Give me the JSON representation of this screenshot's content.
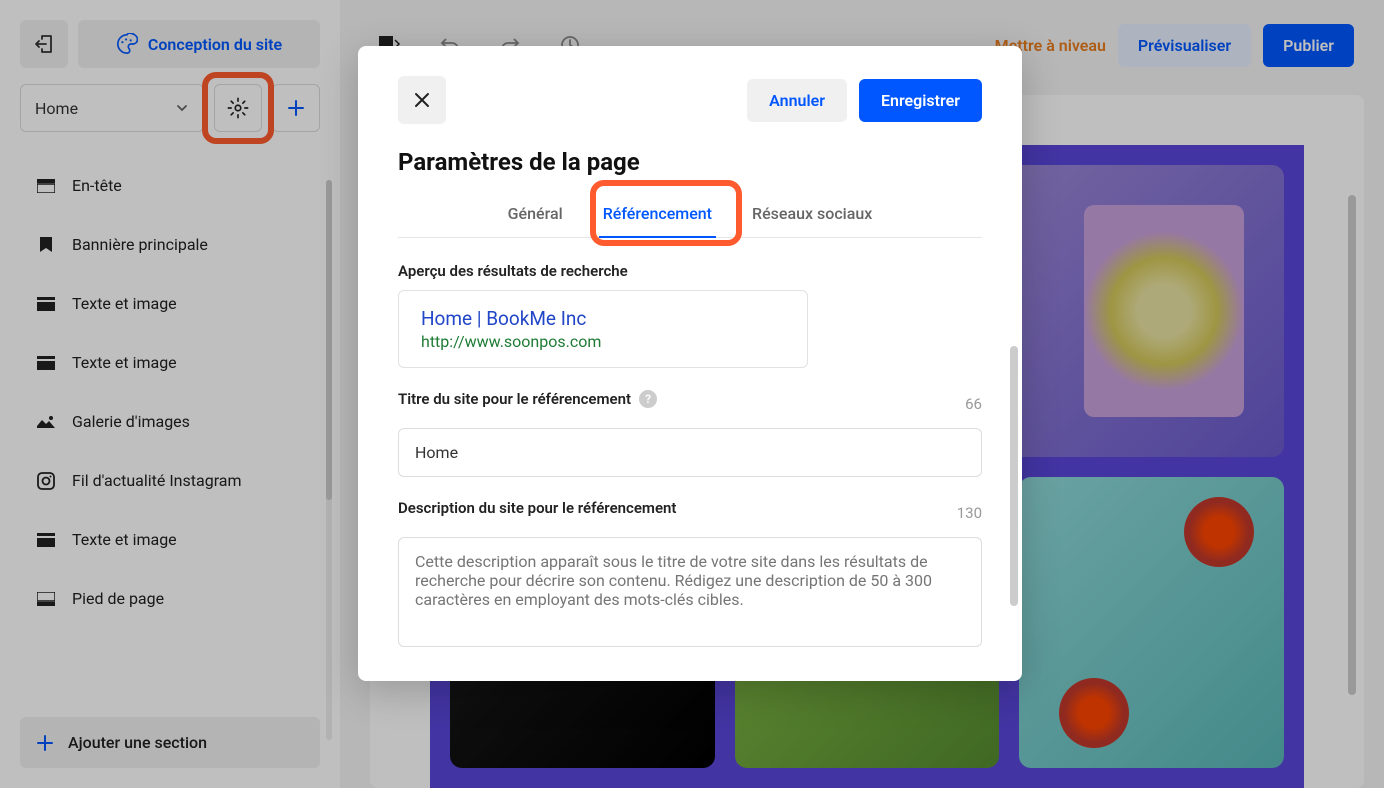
{
  "sidebar": {
    "design_label": "Conception du site",
    "page_select": "Home",
    "sections": [
      {
        "label": "En-tête",
        "icon": "header"
      },
      {
        "label": "Bannière principale",
        "icon": "bookmark"
      },
      {
        "label": "Texte et image",
        "icon": "block"
      },
      {
        "label": "Texte et image",
        "icon": "block"
      },
      {
        "label": "Galerie d'images",
        "icon": "gallery"
      },
      {
        "label": "Fil d'actualité Instagram",
        "icon": "instagram"
      },
      {
        "label": "Texte et image",
        "icon": "block"
      },
      {
        "label": "Pied de page",
        "icon": "footer"
      }
    ],
    "add_section": "Ajouter une section"
  },
  "topbar": {
    "upgrade": "Mettre à niveau",
    "preview": "Prévisualiser",
    "publish": "Publier"
  },
  "modal": {
    "title": "Paramètres de la page",
    "cancel": "Annuler",
    "save": "Enregistrer",
    "tabs": {
      "general": "Général",
      "seo": "Référencement",
      "social": "Réseaux sociaux"
    },
    "preview_label": "Aperçu des résultats de recherche",
    "preview_title": "Home | BookMe Inc",
    "preview_url": "http://www.soonpos.com",
    "seo_title_label": "Titre du site pour le référencement",
    "seo_title_counter": "66",
    "seo_title_value": "Home",
    "seo_desc_label": "Description du site pour le référencement",
    "seo_desc_counter": "130",
    "seo_desc_placeholder": "Cette description apparaît sous le titre de votre site dans les résultats de recherche pour décrire son contenu. Rédigez une description de 50 à 300 caractères en employant des mots-clés cibles."
  }
}
